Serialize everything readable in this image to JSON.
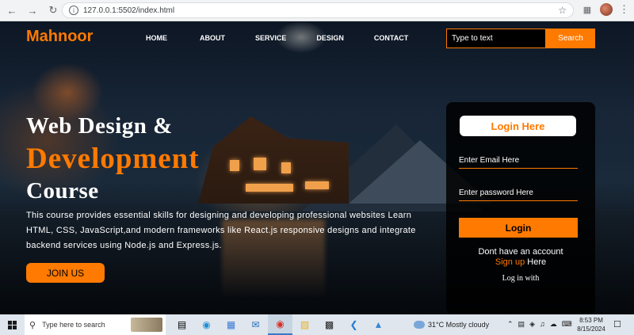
{
  "browser": {
    "url": "127.0.0.1:5502/index.html",
    "back_icon": "arrow-left-icon",
    "forward_icon": "arrow-right-icon",
    "reload_icon": "reload-icon"
  },
  "header": {
    "logo": "Mahnoor",
    "nav": [
      "HOME",
      "ABOUT",
      "SERVICE",
      "DESIGN",
      "CONTACT"
    ],
    "search_placeholder": "Type to text",
    "search_button": "Search"
  },
  "hero": {
    "title_line1": "Web Design &",
    "title_line2": "Development",
    "title_line3": "Course",
    "description": "This course provides essential skills for designing and developing professional websites Learn HTML, CSS, JavaScript,and modern frameworks like React.js responsive designs and integrate backend services using Node.js and Express.js.",
    "join_button": "JOIN US"
  },
  "login": {
    "heading": "Login Here",
    "email_placeholder": "Enter Email Here",
    "password_placeholder": "Enter password Here",
    "login_button": "Login",
    "no_account_text": "Dont have an account",
    "signup_link": "Sign up",
    "signup_suffix": " Here",
    "login_with": "Log in with"
  },
  "taskbar": {
    "search_placeholder": "Type here to search",
    "weather_temp": "31°C",
    "weather_desc": "Mostly cloudy",
    "time": "8:53 PM",
    "date": "8/15/2024"
  },
  "colors": {
    "accent": "#ff7a00",
    "card_bg": "#000000",
    "text": "#ffffff"
  }
}
